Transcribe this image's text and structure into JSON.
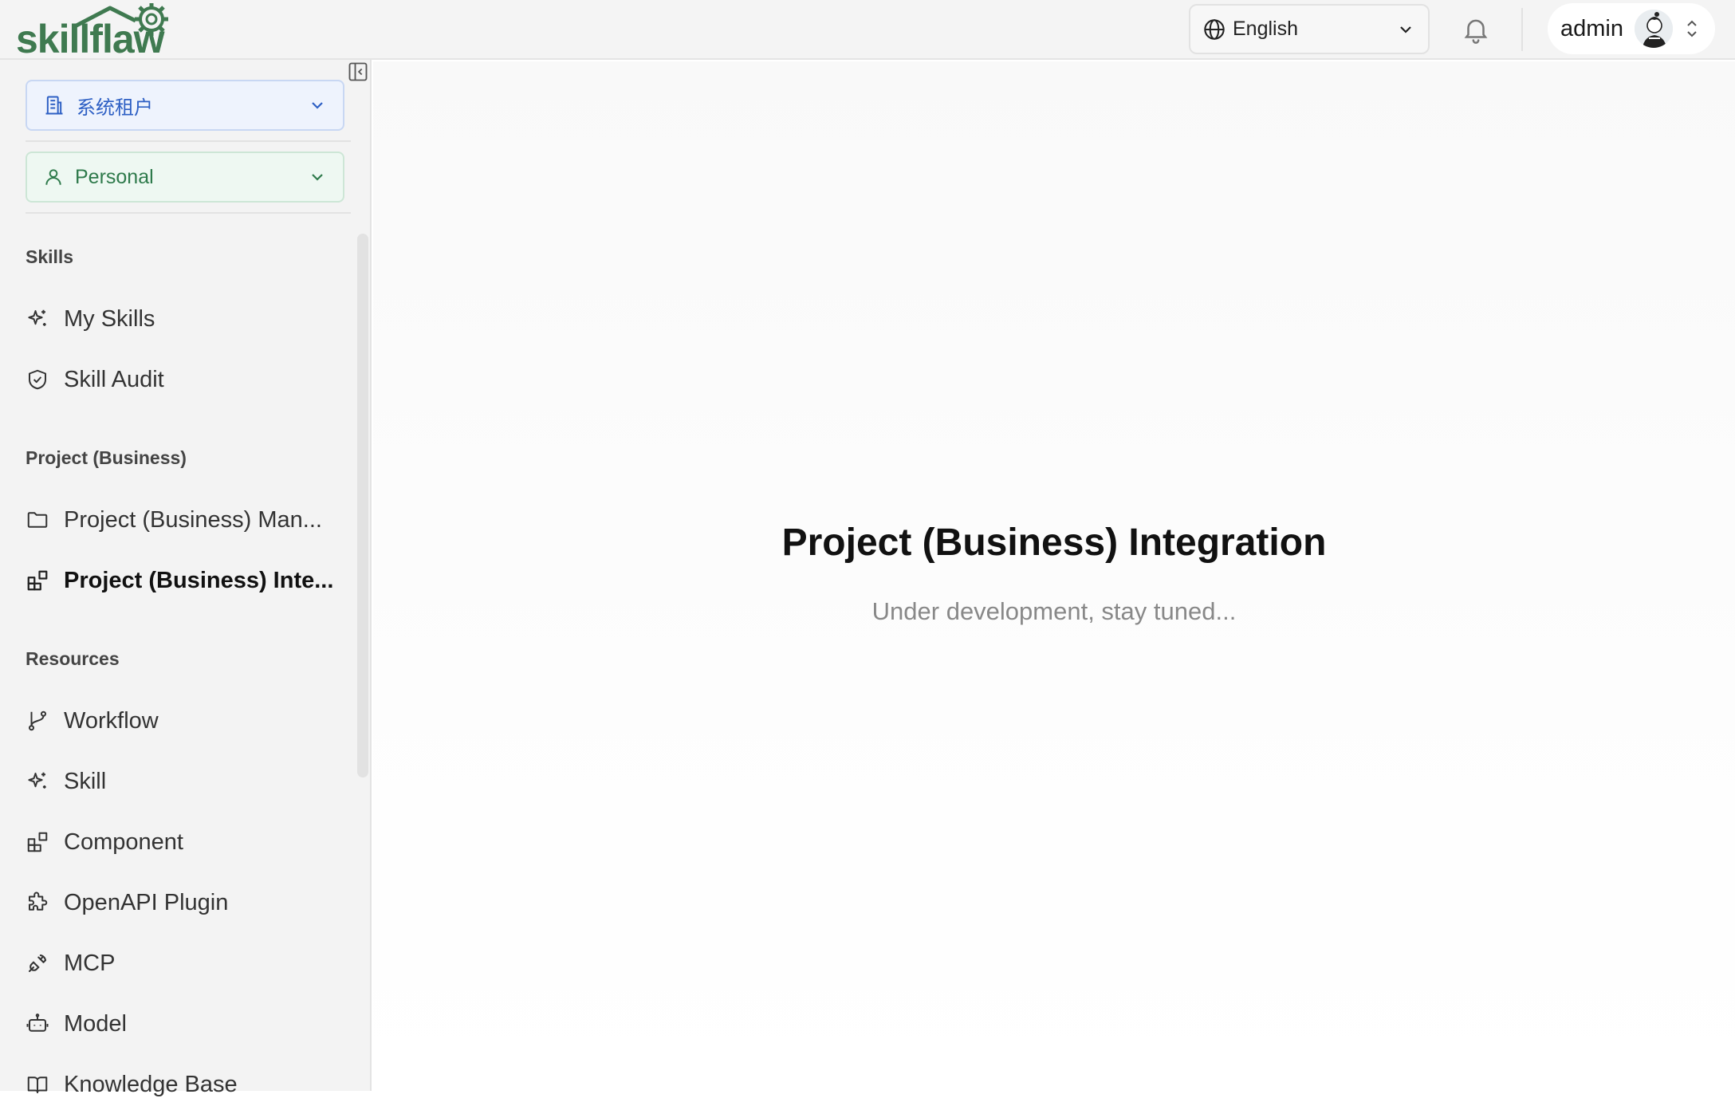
{
  "header": {
    "logo_text": "skillflaw",
    "language": {
      "selected": "English",
      "icon": "globe-icon"
    },
    "notifications_icon": "bell-icon",
    "user": {
      "name": "admin"
    }
  },
  "sidebar": {
    "tenant_select": {
      "value": "系统租户",
      "icon": "building-icon"
    },
    "workspace_select": {
      "value": "Personal",
      "icon": "user-icon"
    },
    "sections": [
      {
        "title": "Skills",
        "items": [
          {
            "label": "My Skills",
            "icon": "sparkle-icon"
          },
          {
            "label": "Skill Audit",
            "icon": "shield-check-icon"
          }
        ]
      },
      {
        "title": "Project (Business)",
        "items": [
          {
            "label": "Project (Business) Man...",
            "icon": "folder-icon"
          },
          {
            "label": "Project (Business) Inte...",
            "icon": "blocks-icon",
            "active": true
          }
        ]
      },
      {
        "title": "Resources",
        "items": [
          {
            "label": "Workflow",
            "icon": "git-branch-icon"
          },
          {
            "label": "Skill",
            "icon": "sparkle-icon"
          },
          {
            "label": "Component",
            "icon": "blocks-icon"
          },
          {
            "label": "OpenAPI Plugin",
            "icon": "puzzle-icon"
          },
          {
            "label": "MCP",
            "icon": "plug-icon"
          },
          {
            "label": "Model",
            "icon": "bot-icon"
          },
          {
            "label": "Knowledge Base",
            "icon": "book-icon"
          }
        ]
      }
    ]
  },
  "main": {
    "title": "Project (Business) Integration",
    "subtitle": "Under development, stay tuned..."
  },
  "colors": {
    "brand_green": "#3f7a50",
    "tenant_blue": "#2d5fc4",
    "personal_green": "#2e7a4b"
  }
}
